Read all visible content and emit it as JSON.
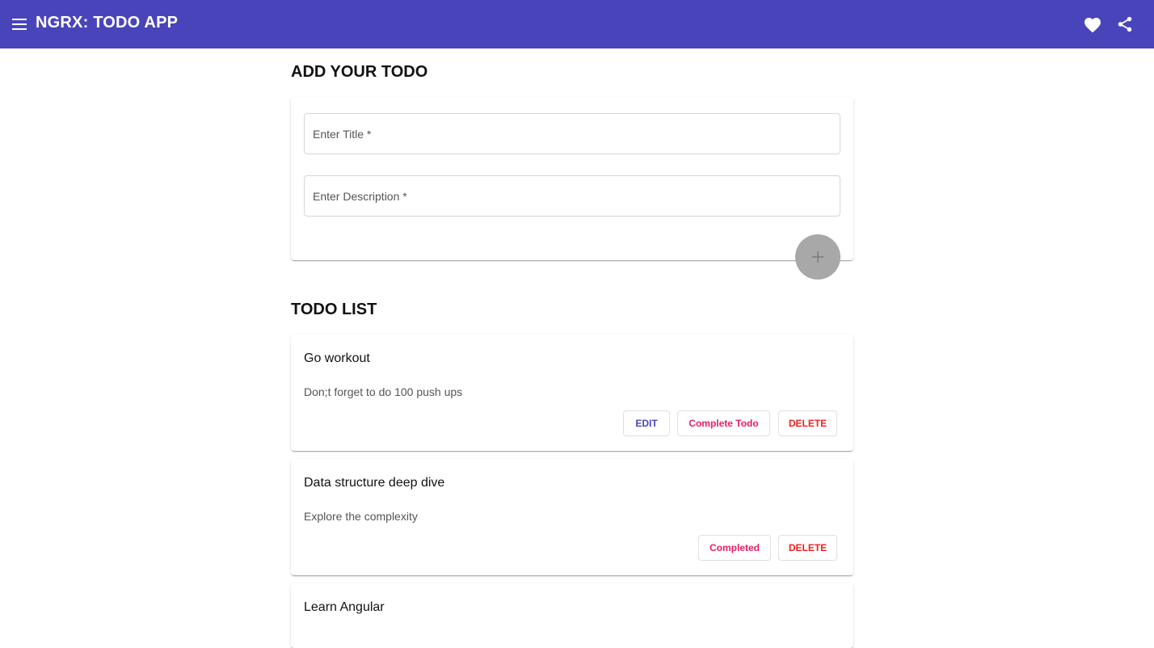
{
  "toolbar": {
    "title": "NGRX: TODO APP",
    "menu_icon": "menu-icon",
    "favorite_icon": "heart-icon",
    "share_icon": "share-icon",
    "color": "#4a44bb"
  },
  "add_section": {
    "heading": "ADD YOUR TODO",
    "title_placeholder": "Enter Title *",
    "title_value": "",
    "description_placeholder": "Enter Description *",
    "description_value": "",
    "add_icon": "plus-icon"
  },
  "list_section": {
    "heading": "TODO LIST",
    "todos": [
      {
        "title": "Go workout",
        "description": "Don;t forget to do 100 push ups",
        "edit_label": "EDIT",
        "complete_label": "Complete Todo",
        "delete_label": "DELETE"
      },
      {
        "title": "Data structure deep dive",
        "description": "Explore the complexity",
        "completed_label": "Completed",
        "delete_label": "DELETE"
      },
      {
        "title": "Learn Angular"
      }
    ]
  },
  "colors": {
    "primary": "#4a44bb",
    "accent": "#e91e63",
    "warn": "#f44336",
    "fab_disabled": "#a8a8a8"
  }
}
